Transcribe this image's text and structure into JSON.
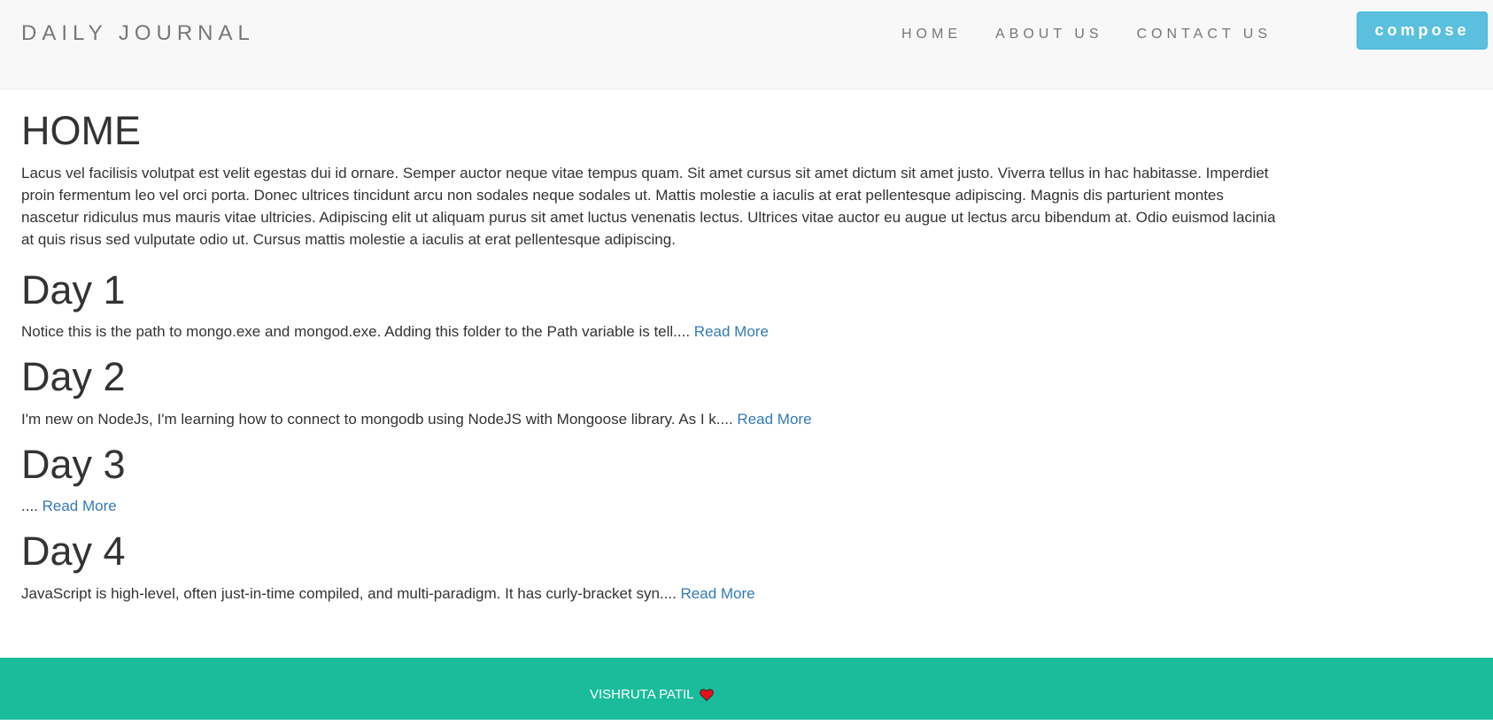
{
  "header": {
    "brand": "DAILY JOURNAL",
    "nav": [
      {
        "label": "HOME"
      },
      {
        "label": "ABOUT US"
      },
      {
        "label": "CONTACT US"
      }
    ],
    "compose_label": "compose"
  },
  "home": {
    "title": "HOME",
    "intro": "Lacus vel facilisis volutpat est velit egestas dui id ornare. Semper auctor neque vitae tempus quam. Sit amet cursus sit amet dictum sit amet justo. Viverra tellus in hac habitasse. Imperdiet proin fermentum leo vel orci porta. Donec ultrices tincidunt arcu non sodales neque sodales ut. Mattis molestie a iaculis at erat pellentesque adipiscing. Magnis dis parturient montes nascetur ridiculus mus mauris vitae ultricies. Adipiscing elit ut aliquam purus sit amet luctus venenatis lectus. Ultrices vitae auctor eu augue ut lectus arcu bibendum at. Odio euismod lacinia at quis risus sed vulputate odio ut. Cursus mattis molestie a iaculis at erat pellentesque adipiscing."
  },
  "posts": [
    {
      "title": "Day 1",
      "excerpt": "Notice this is the path to mongo.exe and mongod.exe. Adding this folder to the Path variable is tell.... ",
      "link": "Read More"
    },
    {
      "title": "Day 2",
      "excerpt": "I'm new on NodeJs, I'm learning how to connect to mongodb using NodeJS with Mongoose library. As I k.... ",
      "link": "Read More"
    },
    {
      "title": "Day 3",
      "excerpt": ".... ",
      "link": "Read More"
    },
    {
      "title": "Day 4",
      "excerpt": "JavaScript is high-level, often just-in-time compiled, and multi-paradigm. It has curly-bracket syn.... ",
      "link": "Read More"
    }
  ],
  "footer": {
    "author": "VISHRUTA PATIL",
    "icon": "heart-icon",
    "icon_color": "#e3111b"
  },
  "colors": {
    "navbar_bg": "#f8f8f8",
    "compose_bg": "#5bc0de",
    "link": "#337ab7",
    "footer_bg": "#1abc9c"
  }
}
